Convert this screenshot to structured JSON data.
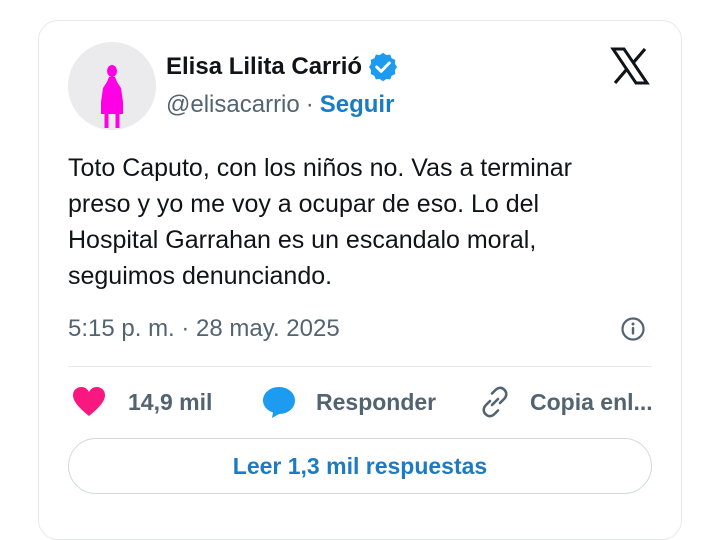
{
  "tweet": {
    "author_name": "Elisa Lilita Carrió",
    "handle": "@elisacarrio",
    "separator": "·",
    "follow_label": "Seguir",
    "text": "Toto Caputo, con los niños no. Vas a terminar preso y yo me voy a ocupar de eso. Lo del Hospital Garrahan es un escandalo moral, seguimos denunciando.",
    "timestamp": "5:15 p. m. · 28 may. 2025",
    "icons": {
      "verified": "verified-badge-icon",
      "platform": "x-logo-icon",
      "info": "info-icon",
      "avatar": "pink-figure-avatar"
    }
  },
  "actions": {
    "likes": "14,9 mil",
    "reply_label": "Responder",
    "copy_label": "Copia enl...",
    "icons": [
      "heart-icon",
      "speech-bubble-icon",
      "link-icon"
    ]
  },
  "read_replies_label": "Leer 1,3 mil respuestas",
  "colors": {
    "text": "#0f1419",
    "muted": "#536471",
    "accent": "#1d7bc3",
    "heart": "#f91880",
    "reply": "#1d9bf0",
    "verified": "#1d9bf0",
    "avatar_figure": "#ff00e6",
    "avatar_bg": "#ebebed",
    "border": "#e6e9eb"
  }
}
